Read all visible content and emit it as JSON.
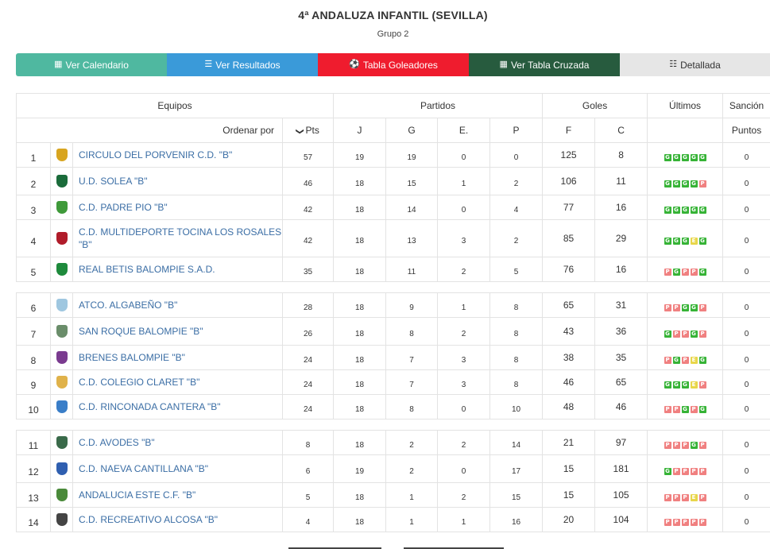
{
  "header": {
    "title": "4ª ANDALUZA INFANTIL (SEVILLA)",
    "subtitle": "Grupo 2"
  },
  "nav": [
    {
      "label": "Ver Calendario",
      "icon": "calendar-icon",
      "glyph": "▦",
      "color": "#4fb8a0"
    },
    {
      "label": "Ver Resultados",
      "icon": "list-icon",
      "glyph": "☰",
      "color": "#3a9ad9"
    },
    {
      "label": "Tabla Goleadores",
      "icon": "soccer-ball-icon",
      "glyph": "⚽",
      "color": "#ef1c2e"
    },
    {
      "label": "Ver Tabla Cruzada",
      "icon": "grid-icon",
      "glyph": "▦",
      "color": "#275b3e"
    },
    {
      "label": "Detallada",
      "icon": "detail-list-icon",
      "glyph": "☷",
      "color": "#e6e6e6"
    }
  ],
  "table": {
    "group_headers": {
      "equipos": "Equipos",
      "partidos": "Partidos",
      "goles": "Goles",
      "ultimos": "Últimos",
      "sancion": "Sanción"
    },
    "columns": {
      "order_by": "Ordenar por",
      "pts": "Pts",
      "j": "J",
      "g": "G",
      "e": "E.",
      "p": "P",
      "f": "F",
      "c": "C",
      "puntos": "Puntos"
    },
    "rows": [
      {
        "pos": "1",
        "team": "CIRCULO DEL PORVENIR C.D. \"B\"",
        "pts": "57",
        "j": "19",
        "g": "19",
        "e": "0",
        "p": "0",
        "f": "125",
        "c": "8",
        "last": [
          "G",
          "G",
          "G",
          "G",
          "G"
        ],
        "sancion": "0",
        "crest": "#d8a520"
      },
      {
        "pos": "2",
        "team": "U.D. SOLEA \"B\"",
        "pts": "46",
        "j": "18",
        "g": "15",
        "e": "1",
        "p": "2",
        "f": "106",
        "c": "11",
        "last": [
          "G",
          "G",
          "G",
          "G",
          "P"
        ],
        "sancion": "0",
        "crest": "#1a6b3a"
      },
      {
        "pos": "3",
        "team": "C.D. PADRE PIO \"B\"",
        "pts": "42",
        "j": "18",
        "g": "14",
        "e": "0",
        "p": "4",
        "f": "77",
        "c": "16",
        "last": [
          "G",
          "G",
          "G",
          "G",
          "G"
        ],
        "sancion": "0",
        "crest": "#3f9a3a"
      },
      {
        "pos": "4",
        "team": "C.D. MULTIDEPORTE TOCINA LOS ROSALES \"B\"",
        "pts": "42",
        "j": "18",
        "g": "13",
        "e": "3",
        "p": "2",
        "f": "85",
        "c": "29",
        "last": [
          "G",
          "G",
          "G",
          "E",
          "G"
        ],
        "sancion": "0",
        "crest": "#b01c2a"
      },
      {
        "pos": "5",
        "team": "REAL BETIS BALOMPIE S.A.D.",
        "pts": "35",
        "j": "18",
        "g": "11",
        "e": "2",
        "p": "5",
        "f": "76",
        "c": "16",
        "last": [
          "P",
          "G",
          "P",
          "P",
          "G"
        ],
        "sancion": "0",
        "crest": "#1e8a3c"
      },
      {
        "pos": "6",
        "team": "ATCO. ALGABEÑO \"B\"",
        "pts": "28",
        "j": "18",
        "g": "9",
        "e": "1",
        "p": "8",
        "f": "65",
        "c": "31",
        "last": [
          "P",
          "P",
          "G",
          "G",
          "P"
        ],
        "sancion": "0",
        "crest": "#9fc7e0"
      },
      {
        "pos": "7",
        "team": "SAN ROQUE BALOMPIE \"B\"",
        "pts": "26",
        "j": "18",
        "g": "8",
        "e": "2",
        "p": "8",
        "f": "43",
        "c": "36",
        "last": [
          "G",
          "P",
          "P",
          "G",
          "P"
        ],
        "sancion": "0",
        "crest": "#6a8d6a"
      },
      {
        "pos": "8",
        "team": "BRENES BALOMPIE \"B\"",
        "pts": "24",
        "j": "18",
        "g": "7",
        "e": "3",
        "p": "8",
        "f": "38",
        "c": "35",
        "last": [
          "P",
          "G",
          "P",
          "E",
          "G"
        ],
        "sancion": "0",
        "crest": "#7a3b8f"
      },
      {
        "pos": "9",
        "team": "C.D. COLEGIO CLARET \"B\"",
        "pts": "24",
        "j": "18",
        "g": "7",
        "e": "3",
        "p": "8",
        "f": "46",
        "c": "65",
        "last": [
          "G",
          "G",
          "G",
          "E",
          "P"
        ],
        "sancion": "0",
        "crest": "#e0b24a"
      },
      {
        "pos": "10",
        "team": "C.D. RINCONADA CANTERA \"B\"",
        "pts": "24",
        "j": "18",
        "g": "8",
        "e": "0",
        "p": "10",
        "f": "48",
        "c": "46",
        "last": [
          "P",
          "P",
          "G",
          "P",
          "G"
        ],
        "sancion": "0",
        "crest": "#3a7ec8"
      },
      {
        "pos": "11",
        "team": "C.D. AVODES \"B\"",
        "pts": "8",
        "j": "18",
        "g": "2",
        "e": "2",
        "p": "14",
        "f": "21",
        "c": "97",
        "last": [
          "P",
          "P",
          "P",
          "G",
          "P"
        ],
        "sancion": "0",
        "crest": "#3a6a4a"
      },
      {
        "pos": "12",
        "team": "C.D. NAEVA CANTILLANA \"B\"",
        "pts": "6",
        "j": "19",
        "g": "2",
        "e": "0",
        "p": "17",
        "f": "15",
        "c": "181",
        "last": [
          "G",
          "P",
          "P",
          "P",
          "P"
        ],
        "sancion": "0",
        "crest": "#2f5fb0"
      },
      {
        "pos": "13",
        "team": "ANDALUCIA ESTE C.F. \"B\"",
        "pts": "5",
        "j": "18",
        "g": "1",
        "e": "2",
        "p": "15",
        "f": "15",
        "c": "105",
        "last": [
          "P",
          "P",
          "P",
          "E",
          "P"
        ],
        "sancion": "0",
        "crest": "#4a8a3a"
      },
      {
        "pos": "14",
        "team": "C.D. RECREATIVO ALCOSA \"B\"",
        "pts": "4",
        "j": "18",
        "g": "1",
        "e": "1",
        "p": "16",
        "f": "20",
        "c": "104",
        "last": [
          "P",
          "P",
          "P",
          "P",
          "P"
        ],
        "sancion": "0",
        "crest": "#444444"
      }
    ]
  }
}
